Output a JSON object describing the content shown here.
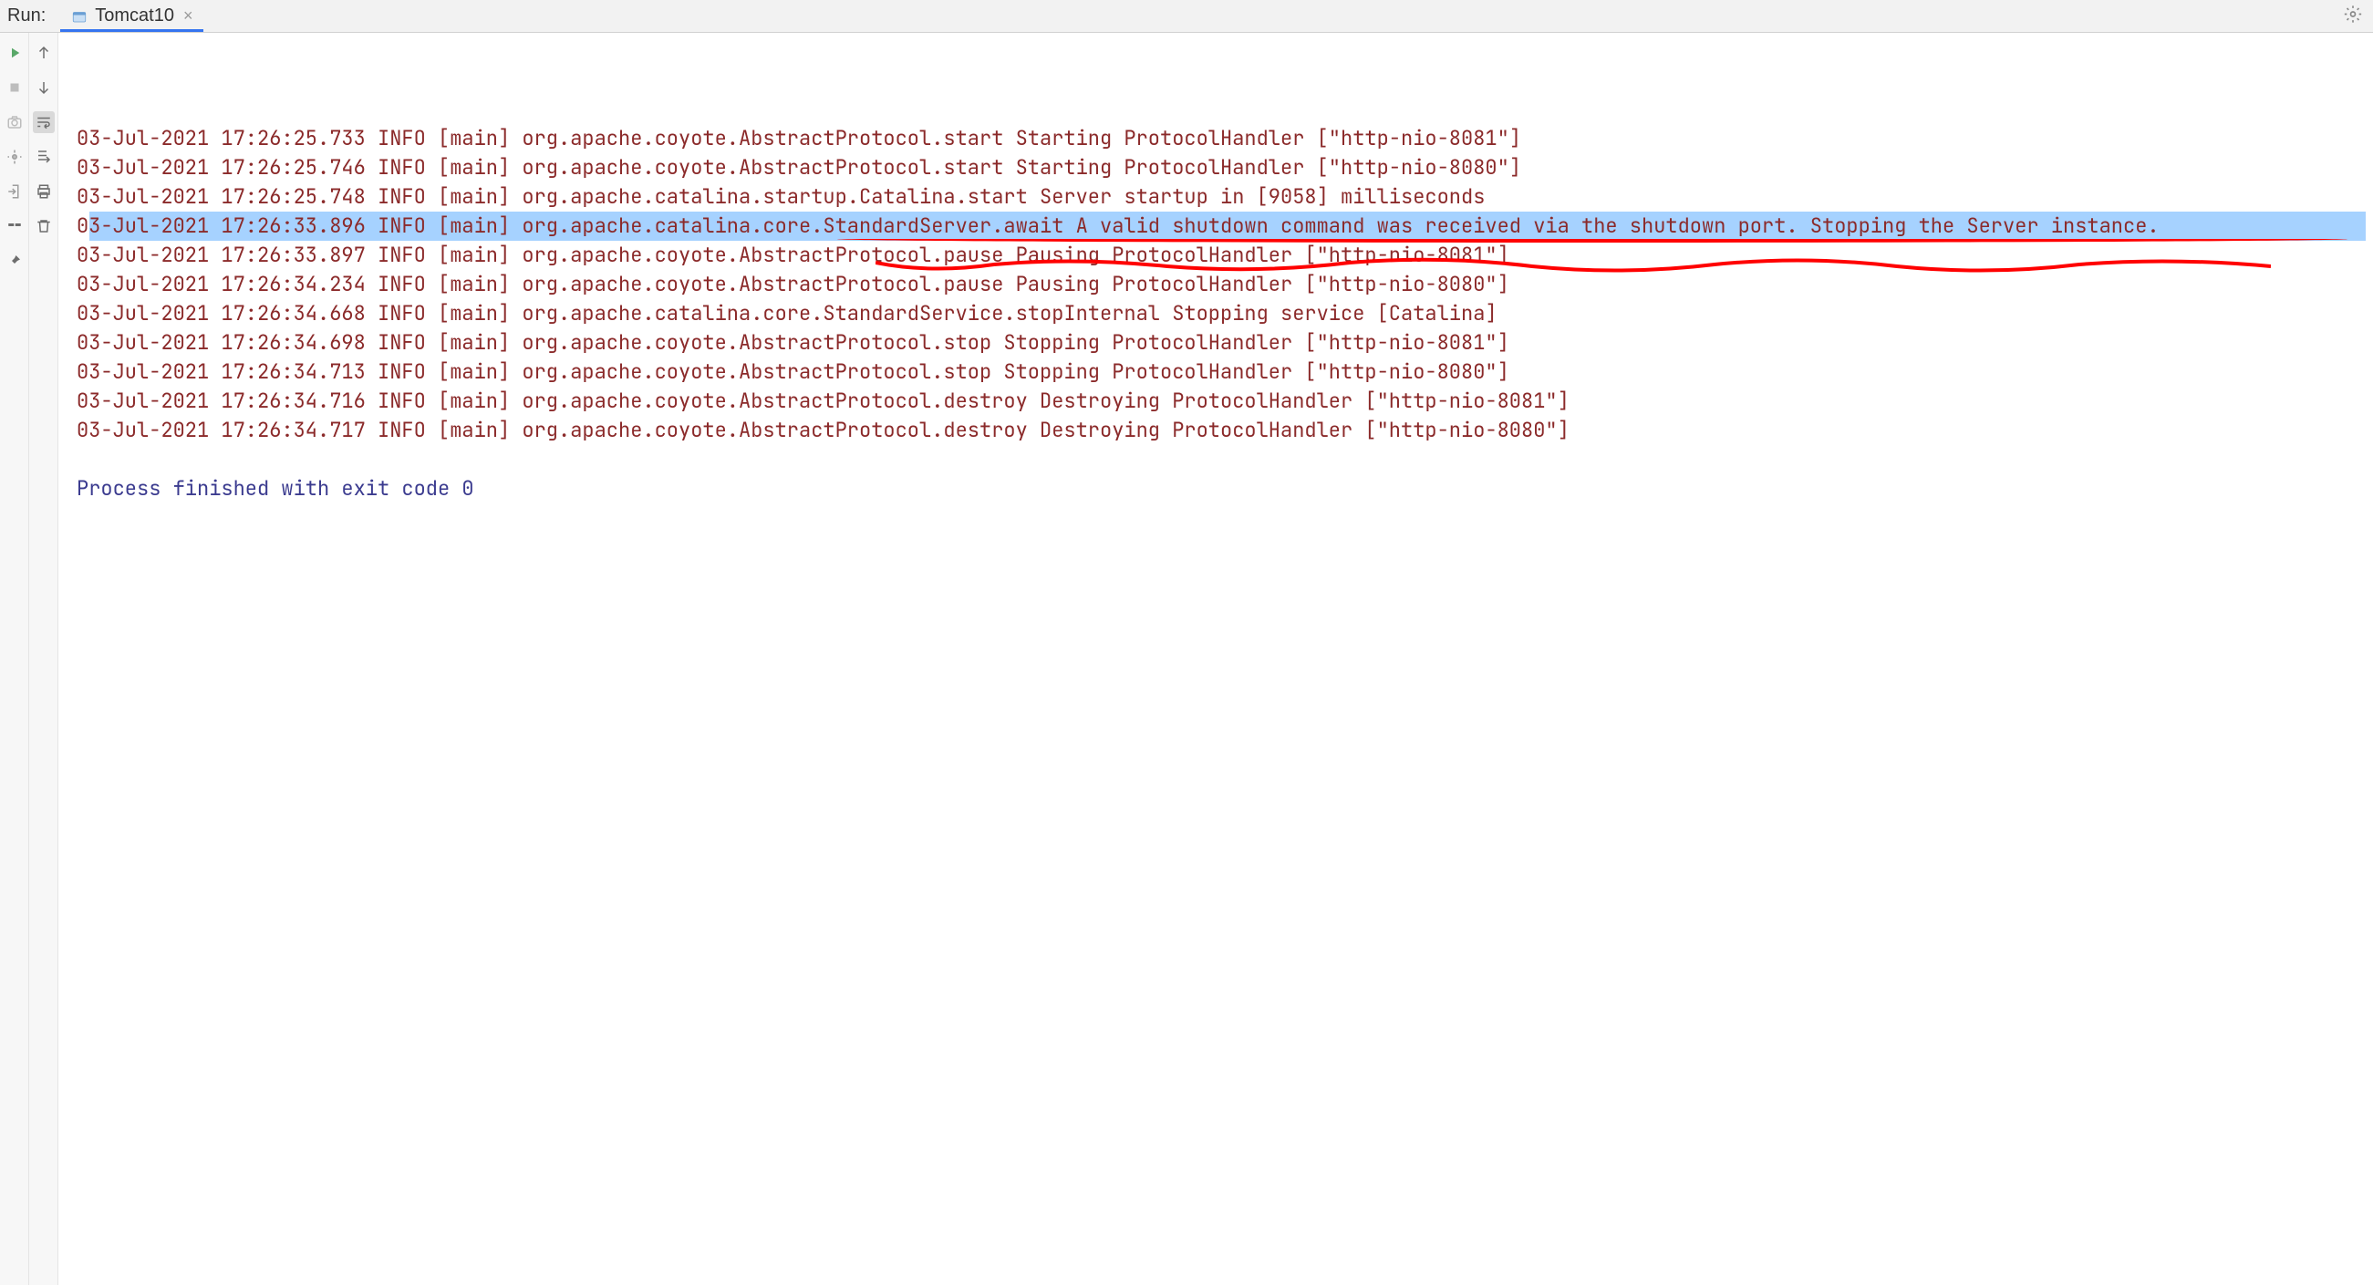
{
  "header": {
    "run_label": "Run:",
    "tab_label": "Tomcat10",
    "tab_close": "×"
  },
  "toolbar": {
    "rerun": "rerun",
    "stop": "stop",
    "camera": "camera",
    "debug": "debug",
    "exit": "exit",
    "hline": "hline",
    "pin": "pin",
    "up": "up",
    "down": "down",
    "wrap": "wrap",
    "scroll": "scroll",
    "print": "print",
    "trash": "trash"
  },
  "log": [
    {
      "text": "03-Jul-2021 17:26:25.733 INFO [main] org.apache.coyote.AbstractProtocol.start Starting ProtocolHandler [\"http-nio-8081\"]",
      "highlighted": false
    },
    {
      "text": "03-Jul-2021 17:26:25.746 INFO [main] org.apache.coyote.AbstractProtocol.start Starting ProtocolHandler [\"http-nio-8080\"]",
      "highlighted": false
    },
    {
      "text": "03-Jul-2021 17:26:25.748 INFO [main] org.apache.catalina.startup.Catalina.start Server startup in [9058] milliseconds",
      "highlighted": false
    },
    {
      "text": "03-Jul-2021 17:26:33.896 INFO [main] org.apache.catalina.core.StandardServer.await A valid shutdown command was received via the shutdown port. Stopping the Server instance.",
      "highlighted": true
    },
    {
      "text": "03-Jul-2021 17:26:33.897 INFO [main] org.apache.coyote.AbstractProtocol.pause Pausing ProtocolHandler [\"http-nio-8081\"]",
      "highlighted": false
    },
    {
      "text": "03-Jul-2021 17:26:34.234 INFO [main] org.apache.coyote.AbstractProtocol.pause Pausing ProtocolHandler [\"http-nio-8080\"]",
      "highlighted": false
    },
    {
      "text": "03-Jul-2021 17:26:34.668 INFO [main] org.apache.catalina.core.StandardService.stopInternal Stopping service [Catalina]",
      "highlighted": false
    },
    {
      "text": "03-Jul-2021 17:26:34.698 INFO [main] org.apache.coyote.AbstractProtocol.stop Stopping ProtocolHandler [\"http-nio-8081\"]",
      "highlighted": false
    },
    {
      "text": "03-Jul-2021 17:26:34.713 INFO [main] org.apache.coyote.AbstractProtocol.stop Stopping ProtocolHandler [\"http-nio-8080\"]",
      "highlighted": false
    },
    {
      "text": "03-Jul-2021 17:26:34.716 INFO [main] org.apache.coyote.AbstractProtocol.destroy Destroying ProtocolHandler [\"http-nio-8081\"]",
      "highlighted": false
    },
    {
      "text": "03-Jul-2021 17:26:34.717 INFO [main] org.apache.coyote.AbstractProtocol.destroy Destroying ProtocolHandler [\"http-nio-8080\"]",
      "highlighted": false
    }
  ],
  "exit_message": "Process finished with exit code 0"
}
